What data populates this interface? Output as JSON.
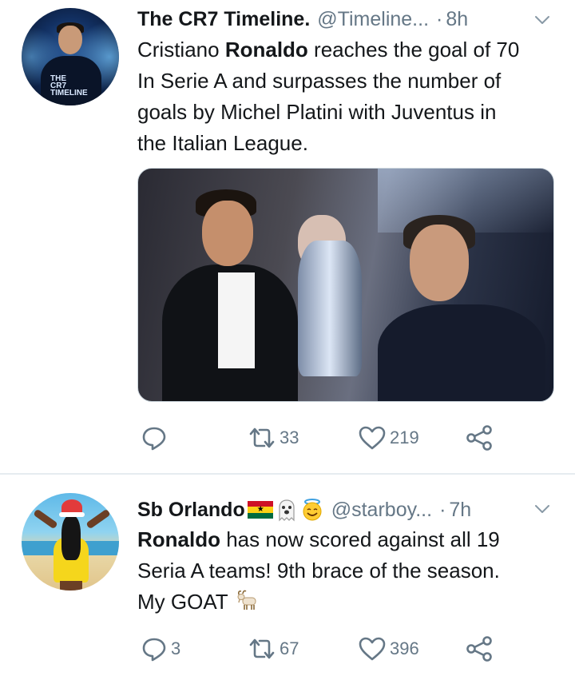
{
  "tweets": [
    {
      "author_name": "The CR7 Timeline.",
      "handle": "@Timeline...",
      "dot": "·",
      "time": "8h",
      "avatar_text": [
        "THE",
        "CR7",
        "TIMELINE"
      ],
      "text_lines": [
        {
          "bold": "",
          "rest": "Cristiano "
        },
        {
          "bold": "",
          "rest": "In Serie A and surpasses the number of"
        },
        {
          "bold": "",
          "rest": "goals by Michel Platini with Juventus in"
        },
        {
          "bold": "",
          "rest": "the Italian League."
        }
      ],
      "line1_bold": "Ronaldo",
      "line1_after": " reaches the goal of 70",
      "reply_count": "",
      "retweet_count": "33",
      "like_count": "219"
    },
    {
      "author_name": "Sb Orlando",
      "handle": "@starboy...",
      "dot": "·",
      "time": "7h",
      "text_lines": [
        {
          "bold": "Ronaldo",
          "rest": " has now scored against all 19"
        },
        {
          "bold": "",
          "rest": "Seria A teams! 9th brace of the season."
        },
        {
          "bold": "",
          "rest": "My GOAT "
        }
      ],
      "reply_count": "3",
      "retweet_count": "67",
      "like_count": "396"
    }
  ],
  "icons": {
    "reply": "reply-icon",
    "retweet": "retweet-icon",
    "like": "heart-icon",
    "share": "share-icon",
    "more": "chevron-down-icon"
  },
  "colors": {
    "text": "#14171a",
    "secondary": "#657786",
    "divider": "#e6ecf0"
  }
}
